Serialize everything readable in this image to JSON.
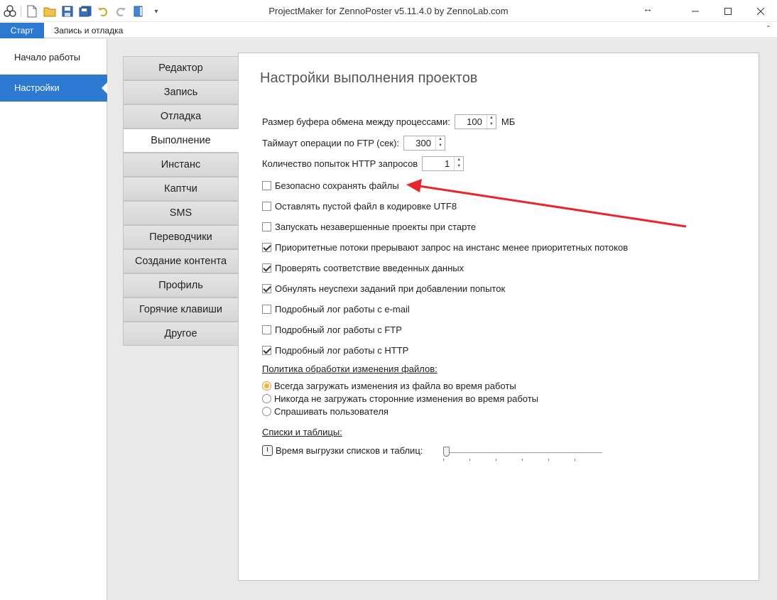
{
  "window": {
    "title": "ProjectMaker for ZennoPoster v5.11.4.0 by ZennoLab.com"
  },
  "ribbon": {
    "tabs": [
      {
        "label": "Старт",
        "active": true
      },
      {
        "label": "Запись и отладка",
        "active": false
      }
    ]
  },
  "left_nav": {
    "items": [
      {
        "label": "Начало работы",
        "active": false
      },
      {
        "label": "Настройки",
        "active": true
      }
    ]
  },
  "settings_tabs": [
    {
      "label": "Редактор"
    },
    {
      "label": "Запись"
    },
    {
      "label": "Отладка"
    },
    {
      "label": "Выполнение",
      "active": true
    },
    {
      "label": "Инстанс"
    },
    {
      "label": "Каптчи"
    },
    {
      "label": "SMS"
    },
    {
      "label": "Переводчики"
    },
    {
      "label": "Создание контента"
    },
    {
      "label": "Профиль"
    },
    {
      "label": "Горячие клавиши"
    },
    {
      "label": "Другое"
    }
  ],
  "panel": {
    "title": "Настройки выполнения проектов",
    "buffer": {
      "label": "Размер буфера обмена между процессами:",
      "value": "100",
      "unit": "МБ"
    },
    "ftp_timeout": {
      "label": "Таймаут операции по FTP (сек):",
      "value": "300"
    },
    "http_retries": {
      "label": "Количество попыток HTTP запросов",
      "value": "1"
    },
    "checkboxes": [
      {
        "label": "Безопасно сохранять файлы",
        "checked": false
      },
      {
        "label": "Оставлять пустой файл в кодировке UTF8",
        "checked": false
      },
      {
        "label": "Запускать незавершенные проекты при старте",
        "checked": false
      },
      {
        "label": "Приоритетные потоки прерывают запрос на инстанс менее приоритетных потоков",
        "checked": true
      },
      {
        "label": "Проверять соответствие введенных данных",
        "checked": true
      },
      {
        "label": "Обнулять неуспехи заданий при добавлении попыток",
        "checked": true
      },
      {
        "label": "Подробный лог работы с e-mail",
        "checked": false
      },
      {
        "label": "Подробный лог работы с FTP",
        "checked": false
      },
      {
        "label": "Подробный лог работы с HTTP",
        "checked": true
      }
    ],
    "file_policy": {
      "heading": "Политика обработки изменения файлов:",
      "options": [
        {
          "label": "Всегда загружать изменения из файла во время работы",
          "selected": true
        },
        {
          "label": "Никогда не загружать сторонние изменения во время работы",
          "selected": false
        },
        {
          "label": "Спрашивать пользователя",
          "selected": false
        }
      ]
    },
    "lists": {
      "heading": "Списки и таблицы:",
      "unload_time_label": "Время выгрузки списков и таблиц:",
      "slider_level": 0
    }
  },
  "colors": {
    "accent": "#2b79d1",
    "annotation_arrow": "#e8262c",
    "content_bg": "#e9e9e9"
  }
}
